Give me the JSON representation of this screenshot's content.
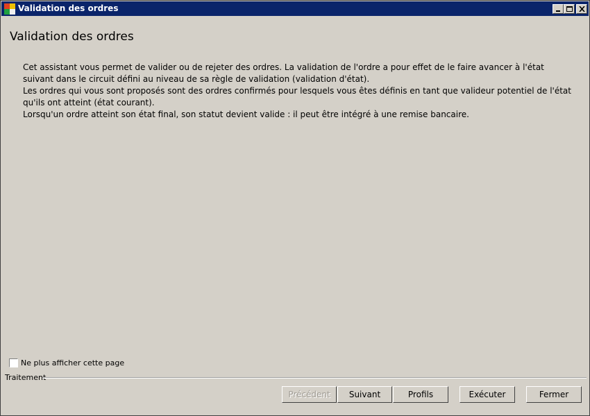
{
  "window": {
    "title": "Validation des ordres",
    "icon": "app-icon",
    "controls": [
      "minimize-icon",
      "maximize-icon",
      "close-icon"
    ]
  },
  "main": {
    "heading": "Validation des ordres",
    "paragraphs": [
      "Cet assistant vous permet de valider ou de rejeter des ordres. La validation de l'ordre a pour effet de le faire avancer à l'état suivant dans le circuit défini au niveau de sa règle de validation (validation d'état).",
      "Les ordres qui vous sont proposés sont des ordres confirmés pour lesquels vous êtes définis en tant que valideur potentiel de l'état qu'ils ont atteint (état courant).",
      "Lorsqu'un ordre atteint son état final, son statut devient valide : il peut être intégré à une remise bancaire."
    ]
  },
  "options": {
    "dont_show_label": "Ne plus afficher cette page",
    "dont_show_checked": false
  },
  "footer": {
    "group_label": "Traitement",
    "buttons": {
      "previous": "Précédent",
      "next": "Suivant",
      "profiles": "Profils",
      "execute": "Exécuter",
      "close": "Fermer"
    },
    "previous_disabled": true
  }
}
